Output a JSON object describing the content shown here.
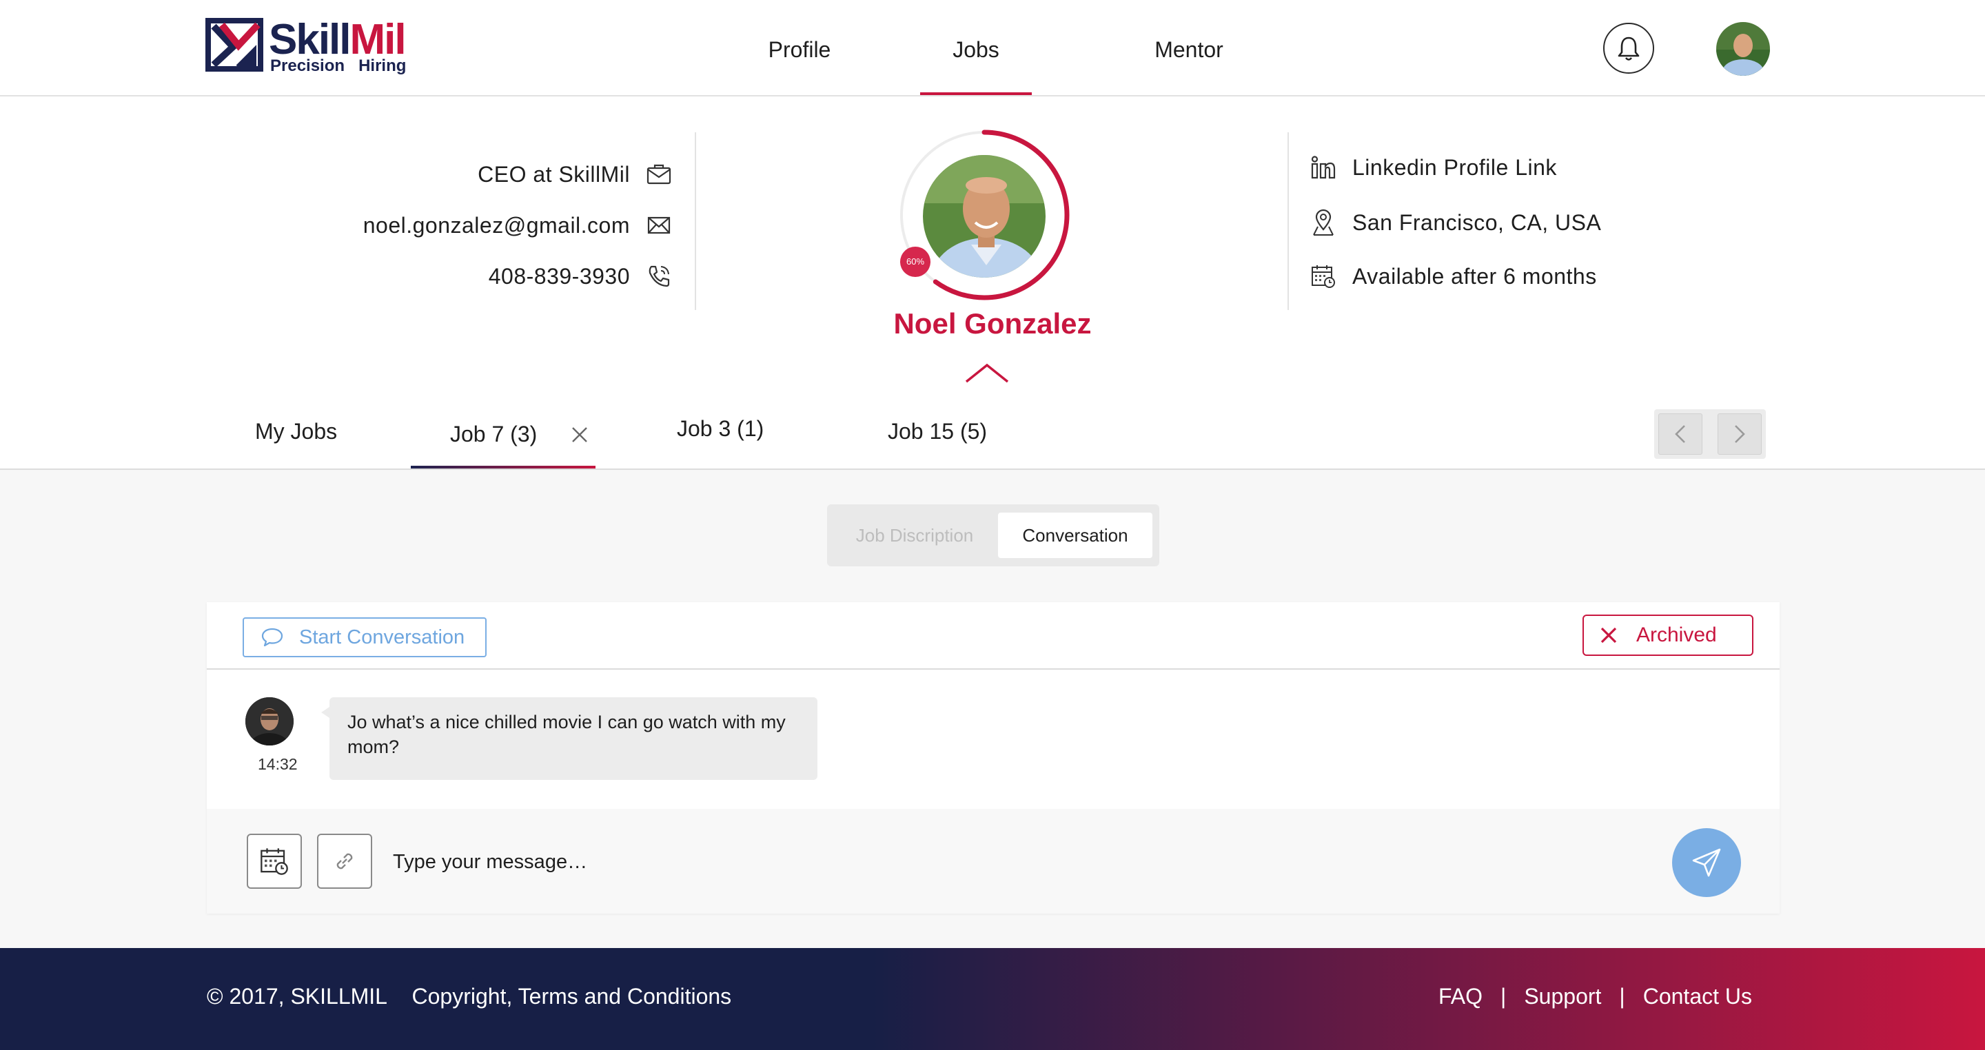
{
  "brand": {
    "name_part1": "Skill",
    "name_part2": "Mil",
    "tagline_1": "Precision",
    "tagline_2": "Hiring",
    "navy": "#1b2350",
    "red": "#c8163f"
  },
  "nav": {
    "items": [
      {
        "label": "Profile"
      },
      {
        "label": "Jobs",
        "active": true
      },
      {
        "label": "Mentor"
      }
    ]
  },
  "header": {
    "bell_icon": "bell-icon",
    "avatar": "user-avatar"
  },
  "profile": {
    "title": "CEO at SkillMil",
    "email": "noel.gonzalez@gmail.com",
    "phone": "408-839-3930",
    "linkedin": "Linkedin Profile Link",
    "location": "San Francisco, CA, USA",
    "availability": "Available after 6 months",
    "name": "Noel Gonzalez",
    "completion_label": "60%",
    "completion": 0.6
  },
  "job_tabs": {
    "tabs": [
      {
        "label": "My Jobs"
      },
      {
        "label": "Job 7 (3)",
        "active": true,
        "closable": true
      },
      {
        "label": "Job 3 (1)"
      },
      {
        "label": "Job 15 (5)"
      }
    ]
  },
  "view_switch": {
    "options": [
      {
        "label": "Job Discription",
        "active": false
      },
      {
        "label": "Conversation",
        "active": true
      }
    ]
  },
  "chat": {
    "start_label": "Start Conversation",
    "archived_label": "Archived",
    "messages": [
      {
        "text": "Jo what’s a nice chilled movie I can go watch with my mom?",
        "time": "14:32"
      }
    ],
    "input_placeholder": "Type your message…"
  },
  "footer": {
    "copyright": "© 2017, SKILLMIL",
    "terms": "Copyright, Terms and Conditions",
    "links": [
      "FAQ",
      "Support",
      "Contact Us"
    ],
    "separator": "|"
  }
}
